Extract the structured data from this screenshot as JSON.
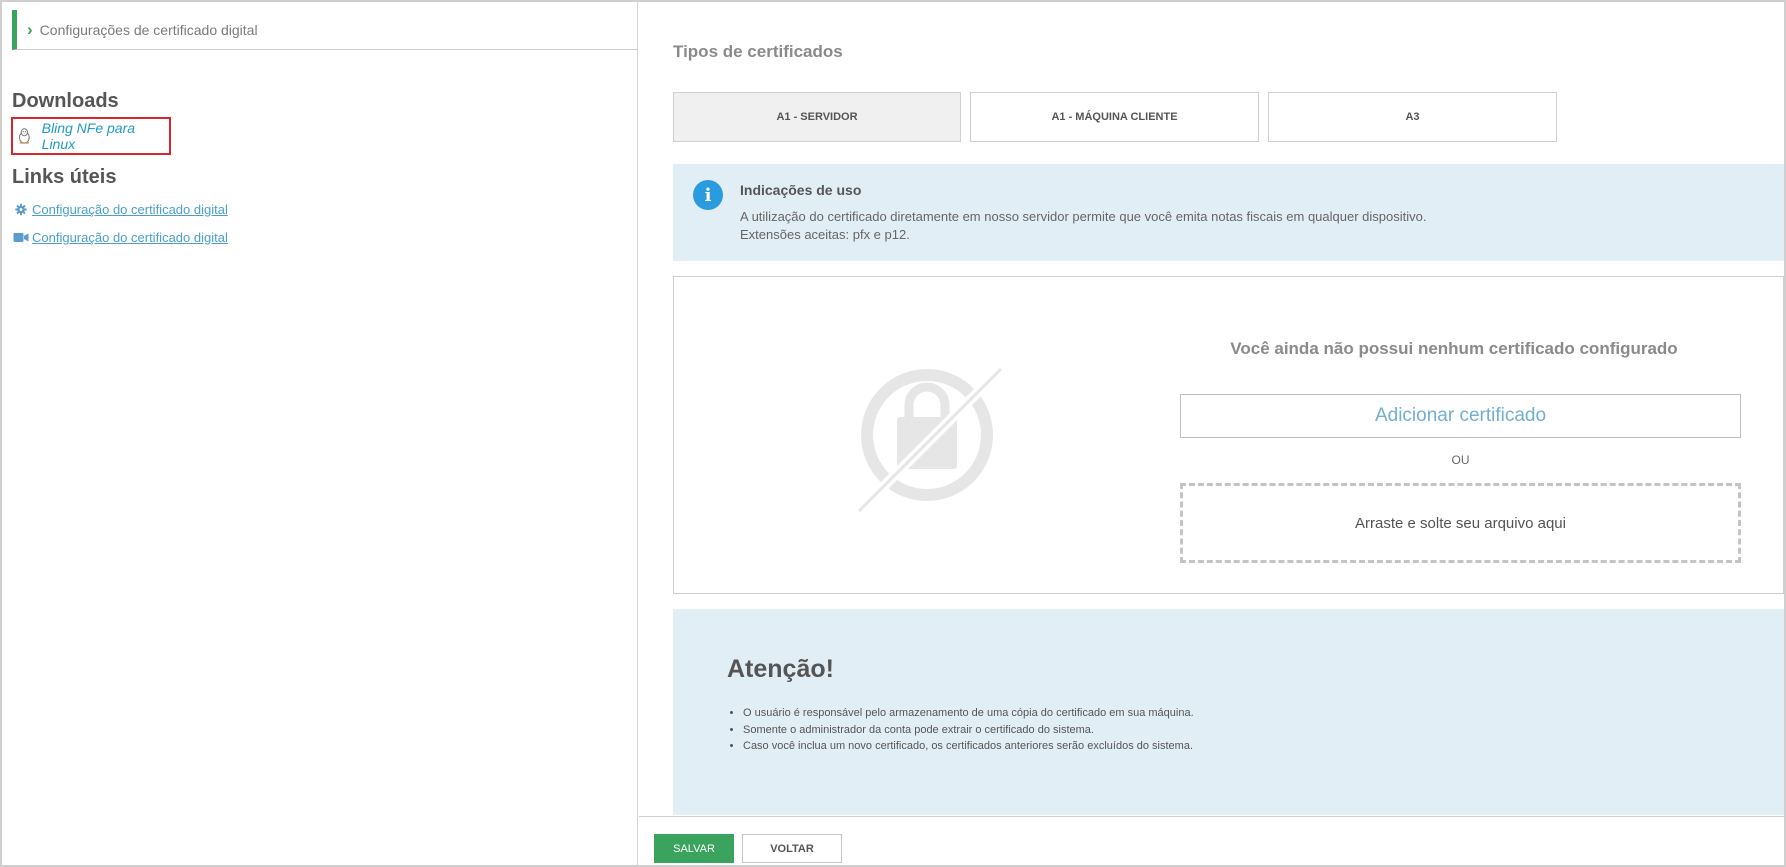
{
  "breadcrumb": {
    "label": "Configurações de certificado digital"
  },
  "downloads": {
    "heading": "Downloads",
    "items": [
      {
        "label": "Bling NFe para Linux",
        "icon": "linux-penguin-icon"
      }
    ]
  },
  "useful_links": {
    "heading": "Links úteis",
    "items": [
      {
        "label": "Configuração do certificado digital",
        "icon": "gear-icon"
      },
      {
        "label": "Configuração do certificado digital",
        "icon": "video-camera-icon"
      }
    ]
  },
  "certificate_types": {
    "title": "Tipos de certificados",
    "tabs": [
      {
        "label": "A1 - SERVIDOR",
        "active": true
      },
      {
        "label": "A1 - MÁQUINA CLIENTE",
        "active": false
      },
      {
        "label": "A3",
        "active": false
      }
    ]
  },
  "usage_info": {
    "icon": "info-icon",
    "title": "Indicações de uso",
    "lines": [
      "A utilização do certificado diretamente em nosso servidor permite que você emita notas fiscais em qualquer dispositivo.",
      "Extensões aceitas: pfx e p12."
    ]
  },
  "certificate_box": {
    "icon": "no-certificate-lock-icon",
    "empty_title": "Você ainda não possui nenhum certificado configurado",
    "add_button": "Adicionar certificado",
    "separator": "OU",
    "dropzone": "Arraste e solte seu arquivo aqui"
  },
  "attention": {
    "title": "Atenção!",
    "items": [
      "O usuário é responsável pelo armazenamento de uma cópia do certificado em sua máquina.",
      "Somente o administrador da conta pode extrair o certificado do sistema.",
      "Caso você inclua um novo certificado, os certificados anteriores serão excluídos do sistema."
    ]
  },
  "footer": {
    "save": "SALVAR",
    "back": "VOLTAR"
  },
  "colors": {
    "accent_green": "#3aa35e",
    "info_bg": "#e2eef6",
    "link_blue": "#4a9fcf",
    "highlight_red": "#d8262a"
  }
}
